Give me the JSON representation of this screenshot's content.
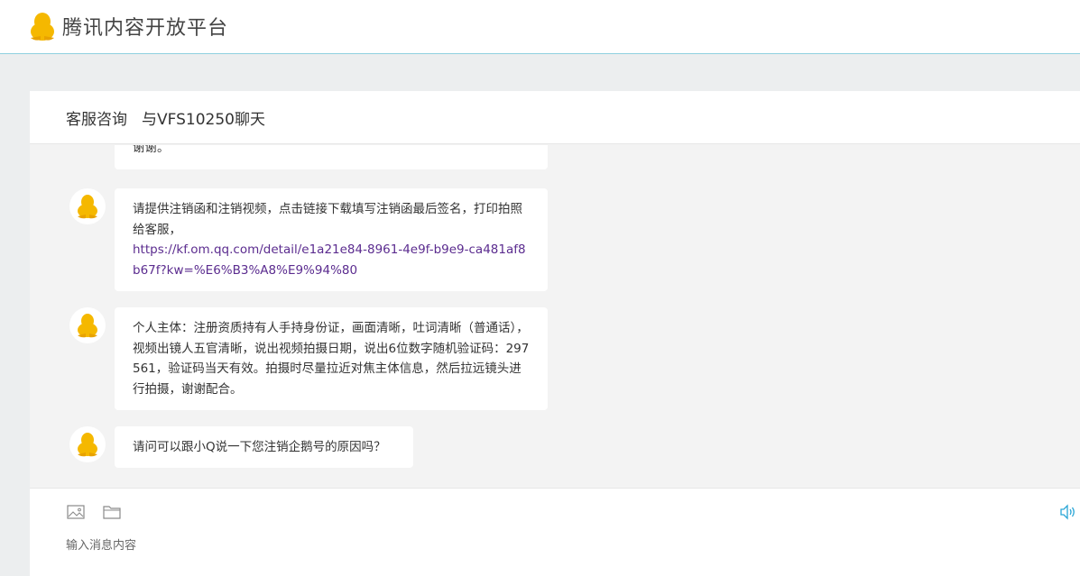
{
  "app": {
    "title": "腾讯内容开放平台",
    "logo_icon": "penguin-logo-icon"
  },
  "conversation": {
    "section": "客服咨询",
    "with_label": "与VFS10250聊天"
  },
  "messages": [
    {
      "avatar_icon": "penguin-avatar-icon",
      "text": "谢谢。"
    },
    {
      "avatar_icon": "penguin-avatar-icon",
      "text": "请提供注销函和注销视频，点击链接下载填写注销函最后签名，打印拍照给客服，",
      "link": "https://kf.om.qq.com/detail/e1a21e84-8961-4e9f-b9e9-ca481af8b67f?kw=%E6%B3%A8%E9%94%80"
    },
    {
      "avatar_icon": "penguin-avatar-icon",
      "text": "个人主体：注册资质持有人手持身份证，画面清晰，吐词清晰（普通话），视频出镜人五官清晰，说出视频拍摄日期，说出6位数字随机验证码：297561，验证码当天有效。拍摄时尽量拉近对焦主体信息，然后拉远镜头进行拍摄，谢谢配合。"
    },
    {
      "avatar_icon": "penguin-avatar-icon",
      "text": "请问可以跟小Q说一下您注销企鹅号的原因吗？"
    }
  ],
  "composer": {
    "tools": [
      "image-icon",
      "folder-icon"
    ],
    "placeholder": "输入消息内容",
    "right_icon": "speaker-icon"
  },
  "colors": {
    "link": "#5b2c8f",
    "logo": "#f5b800",
    "header_border": "#8fd0e0",
    "speaker": "#2aa6d6"
  }
}
